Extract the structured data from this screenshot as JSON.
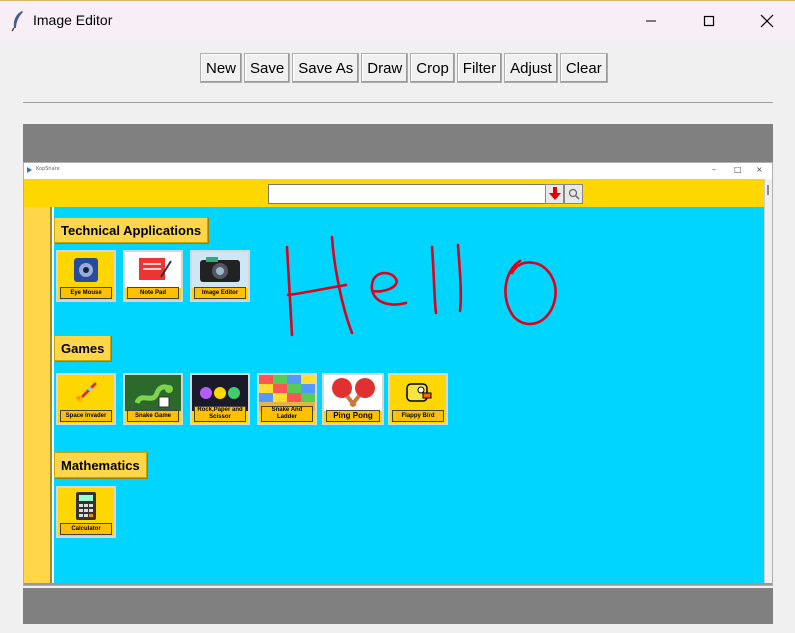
{
  "window": {
    "title": "Image Editor",
    "app_icon": "feather-icon"
  },
  "toolbar": {
    "buttons": [
      "New",
      "Save",
      "Save As",
      "Draw",
      "Crop",
      "Filter",
      "Adjust",
      "Clear"
    ]
  },
  "inner": {
    "title": "KopShare",
    "search": {
      "value": ""
    },
    "sections": {
      "technical": "Technical Applications",
      "games": "Games",
      "mathematics": "Mathematics"
    },
    "tiles": {
      "eye_mouse": "Eye Mouse",
      "note_pad": "Note Pad",
      "image_editor": "Image Editor",
      "space_invader": "Space Invader",
      "snake_game": "Snake Game",
      "rps": "Rock,Paper and Scissor",
      "snake_ladder": "Snake And Ladder",
      "ping_pong": "Ping Pong",
      "flappy_bird": "Flappy Bird",
      "calculator": "Calculator"
    }
  },
  "colors": {
    "accent_yellow": "#ffd700",
    "canvas_cyan": "#00d5ff",
    "ink_red": "#e0001a",
    "grey_bar": "#808080"
  }
}
